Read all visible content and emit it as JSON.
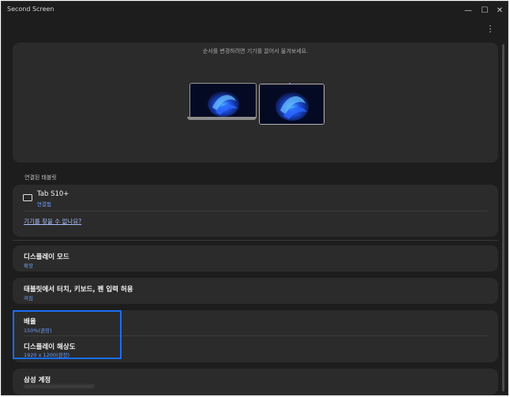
{
  "window": {
    "title": "Second Screen",
    "controls": {
      "minimize": "—",
      "maximize": "☐",
      "close": "✕"
    },
    "menu_icon": "more-vertical-icon"
  },
  "arrange": {
    "hint": "순서를 변경하려면 기기를 끌어서 옮겨보세요."
  },
  "connected": {
    "section_label": "연결된 태블릿",
    "device_name": "Tab S10+",
    "device_status": "연결됨",
    "find_link": "기기를 찾을 수 없나요?"
  },
  "settings": {
    "display_mode": {
      "title": "디스플레이 모드",
      "value": "확장"
    },
    "touch": {
      "title": "태블릿에서 터치, 키보드, 펜 입력 허용",
      "value": "켜짐"
    },
    "scale": {
      "title": "배율",
      "value": "150%(권장)"
    },
    "resolution": {
      "title": "디스플레이 해상도",
      "value": "1920 x 1200(권장)"
    },
    "account": {
      "title": "삼성 계정"
    }
  },
  "colors": {
    "background": "#1d1d1d",
    "panel": "#2b2b2b",
    "accent_text": "#6ea0ff",
    "highlight_border": "#1a6df5"
  }
}
